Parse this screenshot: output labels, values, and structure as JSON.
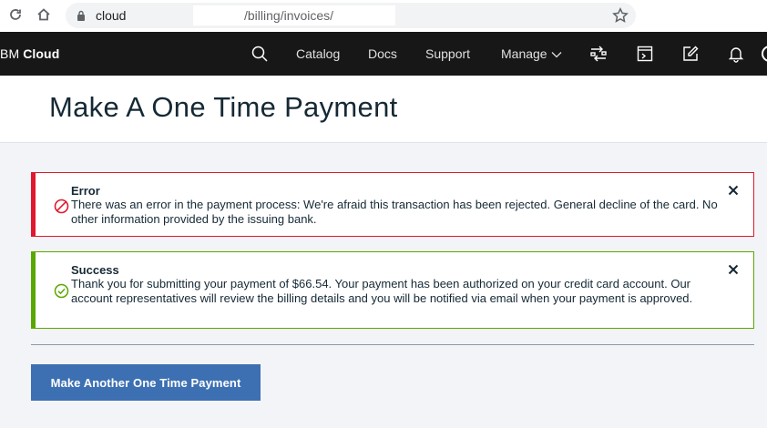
{
  "browser": {
    "url_host": "cloud",
    "url_path": "/billing/invoices/",
    "icons": [
      "reload-icon",
      "home-icon",
      "lock-icon",
      "star-icon"
    ]
  },
  "header": {
    "brand_prefix": "BM ",
    "brand_name": "Cloud",
    "nav": {
      "catalog": "Catalog",
      "docs": "Docs",
      "support": "Support",
      "manage": "Manage"
    },
    "icons": [
      "search-icon",
      "switch-account-icon",
      "terminal-icon",
      "edit-icon",
      "notification-bell-icon"
    ],
    "background": "#171717"
  },
  "page": {
    "title": "Make A One Time Payment"
  },
  "notifications": {
    "error": {
      "title": "Error",
      "message": "There was an error in the payment process: We're afraid this transaction has been rejected. General decline of the card. No other information provided by the issuing bank.",
      "color": "#e0182d",
      "icon": "error-circle-icon"
    },
    "success": {
      "title": "Success",
      "message": "Thank you for submitting your payment of $66.54. Your payment has been authorized on your credit card account. Our account representatives will review the billing details and you will be notified via email when your payment is approved.",
      "color": "#5aa700",
      "icon": "checkmark-circle-icon"
    }
  },
  "actions": {
    "primary_label": "Make Another One Time Payment",
    "primary_color": "#3d70b2"
  }
}
